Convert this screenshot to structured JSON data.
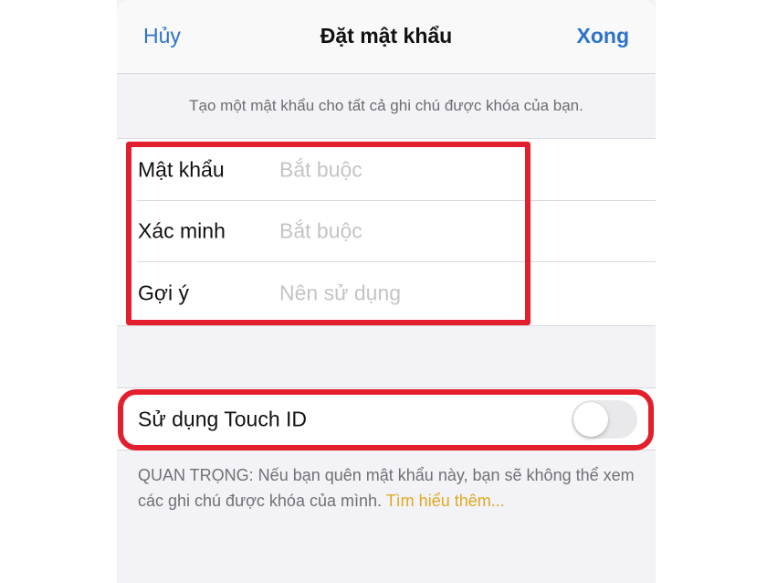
{
  "navbar": {
    "cancel_label": "Hủy",
    "title": "Đặt mật khẩu",
    "done_label": "Xong"
  },
  "description": "Tạo một mật khẩu cho tất cả ghi chú được khóa của bạn.",
  "password_form": {
    "rows": [
      {
        "label": "Mật khẩu",
        "placeholder": "Bắt buộc",
        "value": ""
      },
      {
        "label": "Xác minh",
        "placeholder": "Bắt buộc",
        "value": ""
      },
      {
        "label": "Gợi ý",
        "placeholder": "Nên sử dụng",
        "value": ""
      }
    ]
  },
  "touch_id": {
    "label": "Sử dụng Touch ID",
    "enabled": false
  },
  "footer": {
    "note": "QUAN TRỌNG: Nếu bạn quên mật khẩu này, bạn sẽ không thể xem các ghi chú được khóa của mình.",
    "link_label": "Tìm hiểu thêm..."
  },
  "colors": {
    "accent": "#2d73c9",
    "highlight": "#e41f2d",
    "link": "#e0a91f",
    "background": "#f2f2f7"
  }
}
